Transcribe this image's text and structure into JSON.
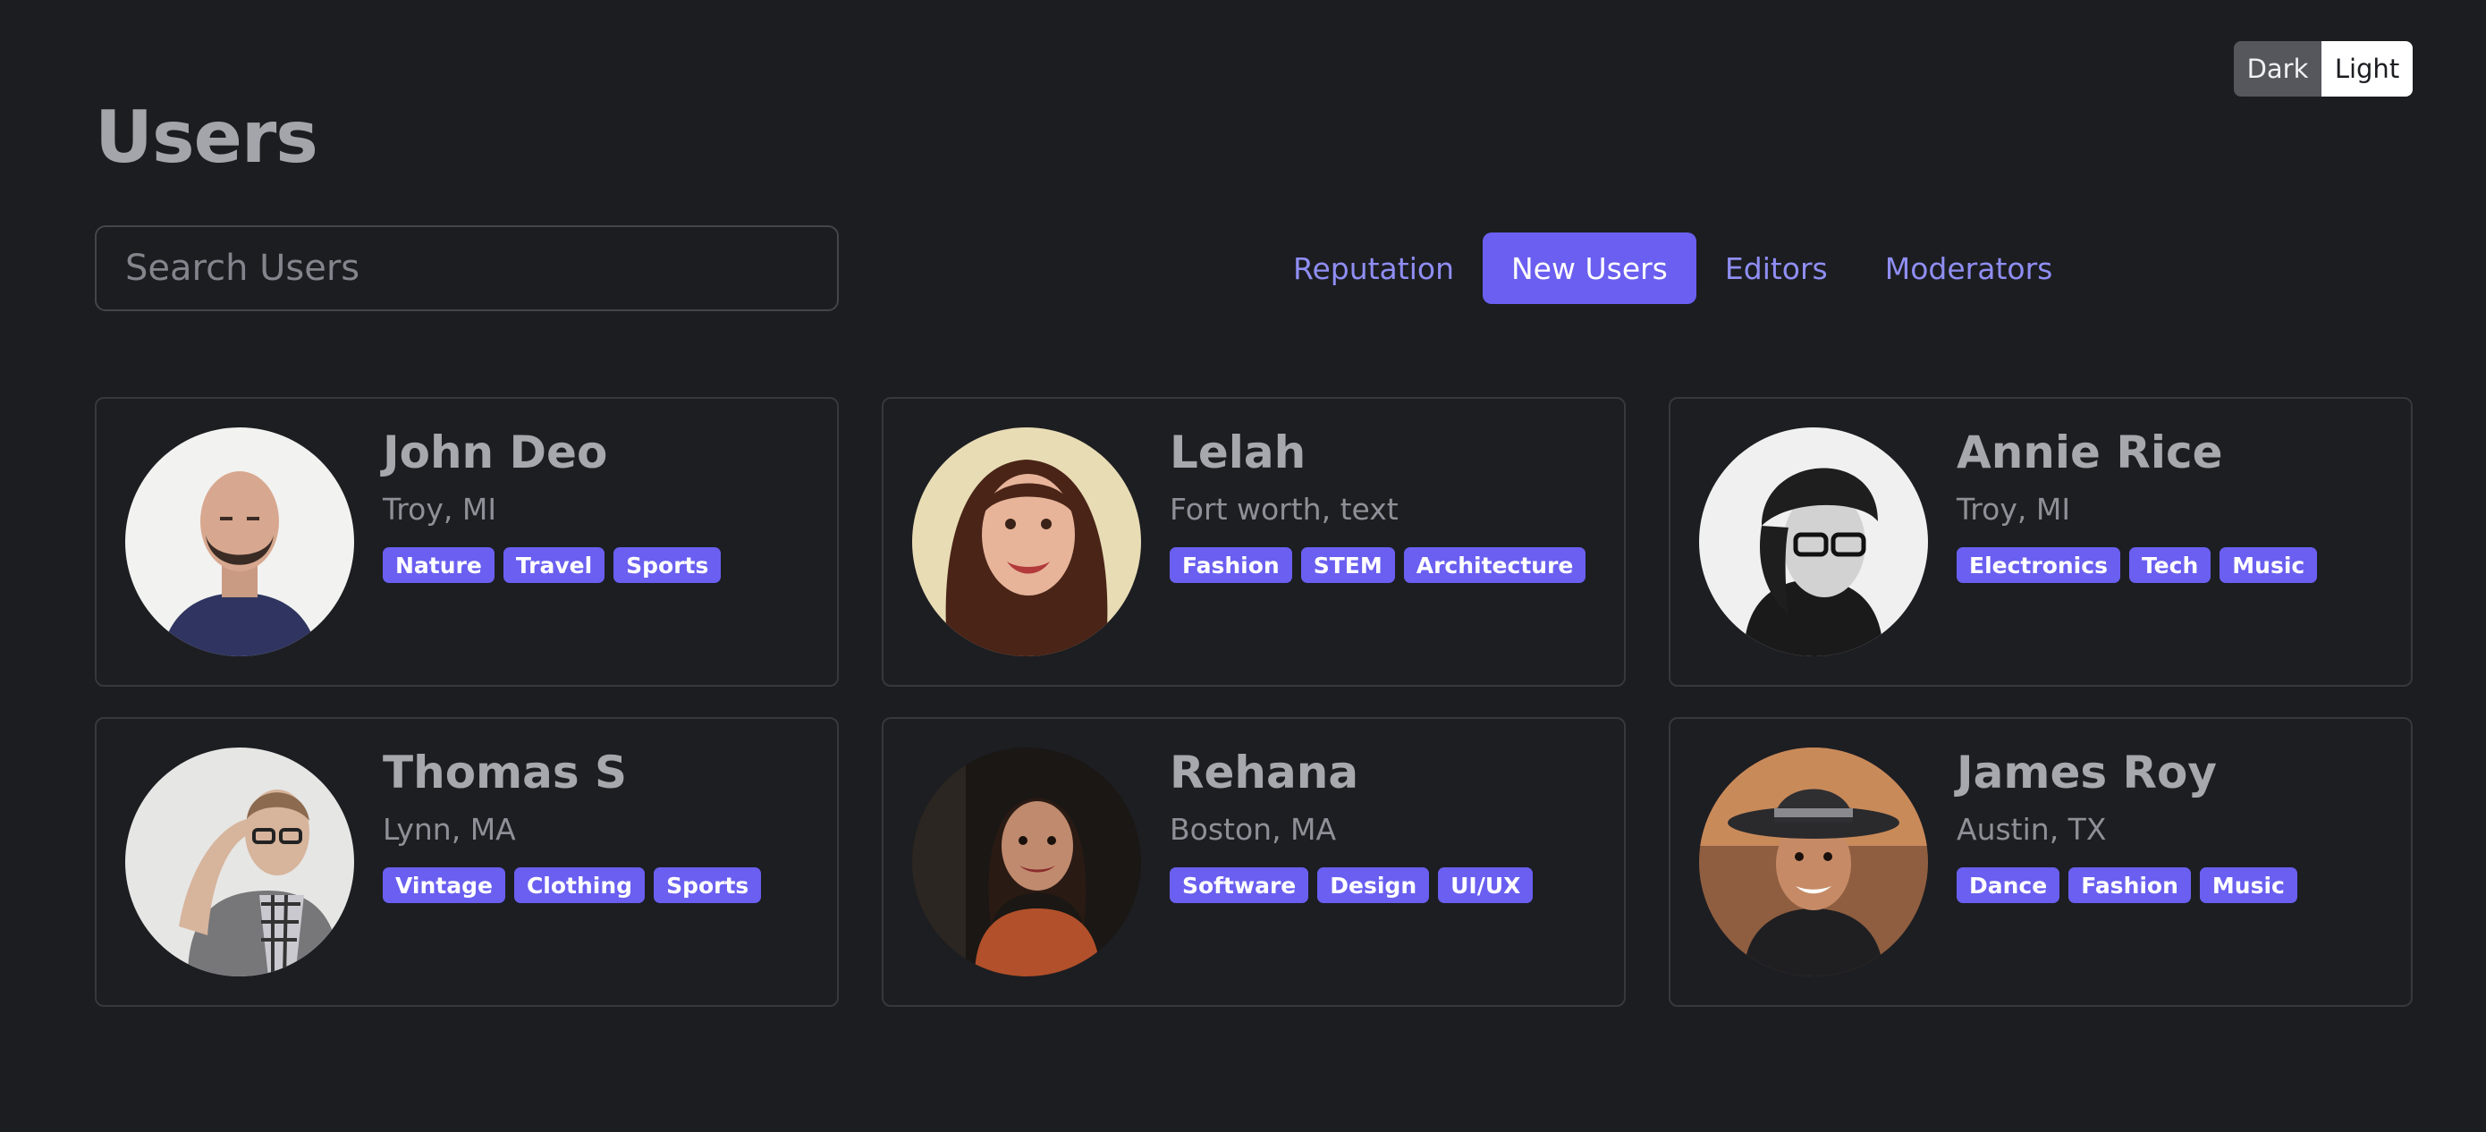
{
  "theme_toggle": {
    "dark_label": "Dark",
    "light_label": "Light"
  },
  "page_title": "Users",
  "search": {
    "placeholder": "Search Users",
    "value": ""
  },
  "tabs": [
    {
      "label": "Reputation",
      "active": false
    },
    {
      "label": "New Users",
      "active": true
    },
    {
      "label": "Editors",
      "active": false
    },
    {
      "label": "Moderators",
      "active": false
    }
  ],
  "users": [
    {
      "name": "John Deo",
      "location": "Troy, MI",
      "tags": [
        "Nature",
        "Travel",
        "Sports"
      ],
      "avatar_icon": "user-photo-icon"
    },
    {
      "name": "Lelah",
      "location": "Fort worth, text",
      "tags": [
        "Fashion",
        "STEM",
        "Architecture"
      ],
      "avatar_icon": "user-photo-icon"
    },
    {
      "name": "Annie Rice",
      "location": "Troy, MI",
      "tags": [
        "Electronics",
        "Tech",
        "Music"
      ],
      "avatar_icon": "user-photo-icon"
    },
    {
      "name": "Thomas S",
      "location": "Lynn, MA",
      "tags": [
        "Vintage",
        "Clothing",
        "Sports"
      ],
      "avatar_icon": "user-photo-icon"
    },
    {
      "name": "Rehana",
      "location": "Boston, MA",
      "tags": [
        "Software",
        "Design",
        "UI/UX"
      ],
      "avatar_icon": "user-photo-icon"
    },
    {
      "name": "James Roy",
      "location": "Austin, TX",
      "tags": [
        "Dance",
        "Fashion",
        "Music"
      ],
      "avatar_icon": "user-photo-icon"
    }
  ],
  "colors": {
    "background": "#1c1d21",
    "accent": "#6a5ff0",
    "tab_text": "#8f8ef3",
    "card_border": "#37383e"
  }
}
